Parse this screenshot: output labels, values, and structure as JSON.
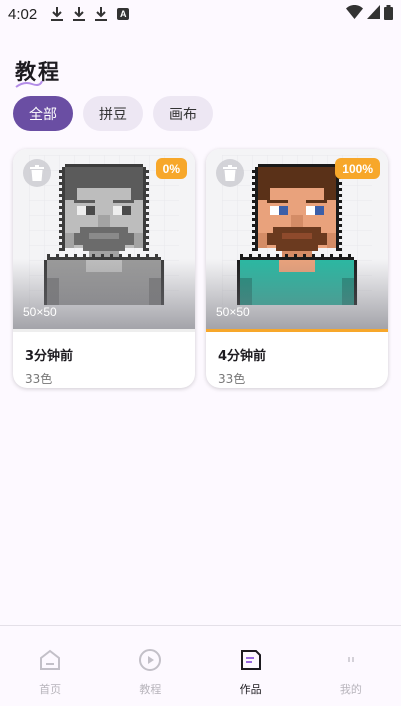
{
  "status_bar": {
    "time": "4:02",
    "a_icon_letter": "A"
  },
  "page": {
    "title": "教程"
  },
  "filters": {
    "items": [
      {
        "label": "全部",
        "active": true
      },
      {
        "label": "拼豆",
        "active": false
      },
      {
        "label": "画布",
        "active": false
      }
    ]
  },
  "works": [
    {
      "progress_label": "0%",
      "progress": 0,
      "size_label": "50×50",
      "time": "3分钟前",
      "colors": "33色",
      "style": "grayscale"
    },
    {
      "progress_label": "100%",
      "progress": 1.0,
      "size_label": "50×50",
      "time": "4分钟前",
      "colors": "33色",
      "style": "color"
    }
  ],
  "bottom_nav": {
    "items": [
      {
        "label": "首页",
        "icon": "home-icon",
        "active": false
      },
      {
        "label": "教程",
        "icon": "play-circle-icon",
        "active": false
      },
      {
        "label": "作品",
        "icon": "works-icon",
        "active": true
      },
      {
        "label": "我的",
        "icon": "profile-icon",
        "active": false
      }
    ]
  },
  "colors": {
    "accent": "#6a4ea3",
    "badge": "#f7a72a",
    "background": "#fdf9ff"
  }
}
